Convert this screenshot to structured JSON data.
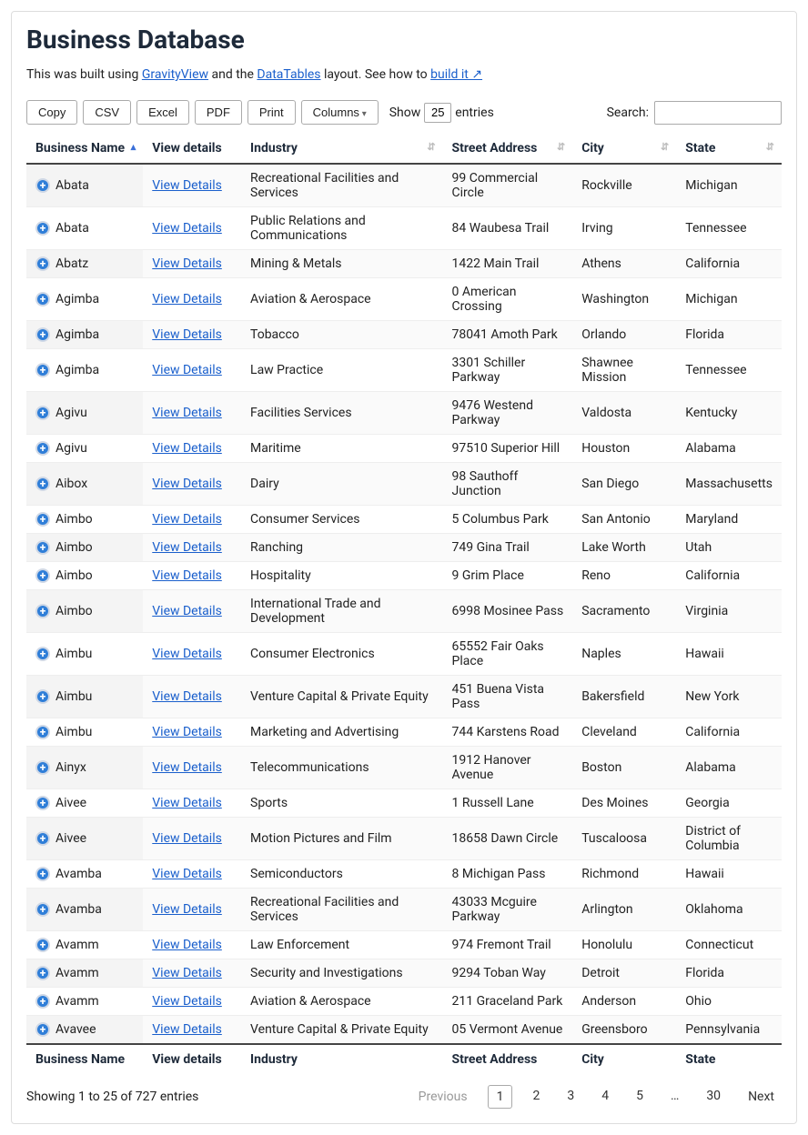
{
  "header": {
    "title": "Business Database",
    "intro_prefix": "This was built using ",
    "intro_link1": "GravityView",
    "intro_mid": " and the ",
    "intro_link2": "DataTables",
    "intro_suffix": " layout. See how to ",
    "intro_link3": "build it ↗"
  },
  "toolbar": {
    "copy": "Copy",
    "csv": "CSV",
    "excel": "Excel",
    "pdf": "PDF",
    "print": "Print",
    "columns": "Columns",
    "show_prefix": "Show",
    "show_value": "25",
    "show_suffix": "entries",
    "search_label": "Search:",
    "search_value": ""
  },
  "columns": {
    "business_name": "Business Name",
    "view_details": "View details",
    "industry": "Industry",
    "street_address": "Street Address",
    "city": "City",
    "state": "State"
  },
  "view_details_label": "View Details",
  "rows": [
    {
      "name": "Abata",
      "industry": "Recreational Facilities and Services",
      "address": "99 Commercial Circle",
      "city": "Rockville",
      "state": "Michigan"
    },
    {
      "name": "Abata",
      "industry": "Public Relations and Communications",
      "address": "84 Waubesa Trail",
      "city": "Irving",
      "state": "Tennessee"
    },
    {
      "name": "Abatz",
      "industry": "Mining & Metals",
      "address": "1422 Main Trail",
      "city": "Athens",
      "state": "California"
    },
    {
      "name": "Agimba",
      "industry": "Aviation & Aerospace",
      "address": "0 American Crossing",
      "city": "Washington",
      "state": "Michigan"
    },
    {
      "name": "Agimba",
      "industry": "Tobacco",
      "address": "78041 Amoth Park",
      "city": "Orlando",
      "state": "Florida"
    },
    {
      "name": "Agimba",
      "industry": "Law Practice",
      "address": "3301 Schiller Parkway",
      "city": "Shawnee Mission",
      "state": "Tennessee"
    },
    {
      "name": "Agivu",
      "industry": "Facilities Services",
      "address": "9476 Westend Parkway",
      "city": "Valdosta",
      "state": "Kentucky"
    },
    {
      "name": "Agivu",
      "industry": "Maritime",
      "address": "97510 Superior Hill",
      "city": "Houston",
      "state": "Alabama"
    },
    {
      "name": "Aibox",
      "industry": "Dairy",
      "address": "98 Sauthoff Junction",
      "city": "San Diego",
      "state": "Massachusetts"
    },
    {
      "name": "Aimbo",
      "industry": "Consumer Services",
      "address": "5 Columbus Park",
      "city": "San Antonio",
      "state": "Maryland"
    },
    {
      "name": "Aimbo",
      "industry": "Ranching",
      "address": "749 Gina Trail",
      "city": "Lake Worth",
      "state": "Utah"
    },
    {
      "name": "Aimbo",
      "industry": "Hospitality",
      "address": "9 Grim Place",
      "city": "Reno",
      "state": "California"
    },
    {
      "name": "Aimbo",
      "industry": "International Trade and Development",
      "address": "6998 Mosinee Pass",
      "city": "Sacramento",
      "state": "Virginia"
    },
    {
      "name": "Aimbu",
      "industry": "Consumer Electronics",
      "address": "65552 Fair Oaks Place",
      "city": "Naples",
      "state": "Hawaii"
    },
    {
      "name": "Aimbu",
      "industry": "Venture Capital & Private Equity",
      "address": "451 Buena Vista Pass",
      "city": "Bakersfield",
      "state": "New York"
    },
    {
      "name": "Aimbu",
      "industry": "Marketing and Advertising",
      "address": "744 Karstens Road",
      "city": "Cleveland",
      "state": "California"
    },
    {
      "name": "Ainyx",
      "industry": "Telecommunications",
      "address": "1912 Hanover Avenue",
      "city": "Boston",
      "state": "Alabama"
    },
    {
      "name": "Aivee",
      "industry": "Sports",
      "address": "1 Russell Lane",
      "city": "Des Moines",
      "state": "Georgia"
    },
    {
      "name": "Aivee",
      "industry": "Motion Pictures and Film",
      "address": "18658 Dawn Circle",
      "city": "Tuscaloosa",
      "state": "District of Columbia"
    },
    {
      "name": "Avamba",
      "industry": "Semiconductors",
      "address": "8 Michigan Pass",
      "city": "Richmond",
      "state": "Hawaii"
    },
    {
      "name": "Avamba",
      "industry": "Recreational Facilities and Services",
      "address": "43033 Mcguire Parkway",
      "city": "Arlington",
      "state": "Oklahoma"
    },
    {
      "name": "Avamm",
      "industry": "Law Enforcement",
      "address": "974 Fremont Trail",
      "city": "Honolulu",
      "state": "Connecticut"
    },
    {
      "name": "Avamm",
      "industry": "Security and Investigations",
      "address": "9294 Toban Way",
      "city": "Detroit",
      "state": "Florida"
    },
    {
      "name": "Avamm",
      "industry": "Aviation & Aerospace",
      "address": "211 Graceland Park",
      "city": "Anderson",
      "state": "Ohio"
    },
    {
      "name": "Avavee",
      "industry": "Venture Capital & Private Equity",
      "address": "05 Vermont Avenue",
      "city": "Greensboro",
      "state": "Pennsylvania"
    }
  ],
  "footer": {
    "info": "Showing 1 to 25 of 727 entries",
    "previous": "Previous",
    "next": "Next",
    "pages": [
      "1",
      "2",
      "3",
      "4",
      "5",
      "…",
      "30"
    ],
    "current_page": "1"
  }
}
